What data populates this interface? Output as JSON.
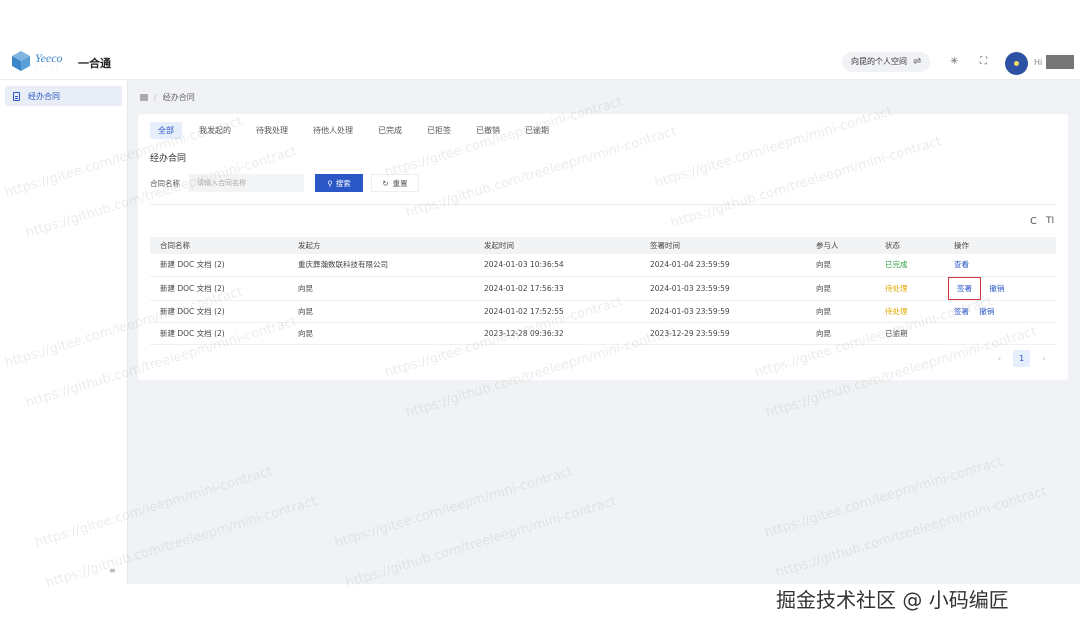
{
  "app": {
    "logo_brand": "Yeeco",
    "title": "一合通"
  },
  "topbar": {
    "space_label": "向昆的个人空间",
    "switch_symbol": "⇌",
    "theme_symbol": "✳",
    "fullscreen_symbol": "⛶",
    "greeting": "Hi"
  },
  "sidebar": {
    "items": [
      {
        "label": "经办合同",
        "icon": "document-icon",
        "active": true
      }
    ],
    "collapse_symbol": "≡"
  },
  "breadcrumb": {
    "current": "经办合同"
  },
  "tabs": [
    {
      "label": "全部",
      "active": true
    },
    {
      "label": "我发起的"
    },
    {
      "label": "待我处理"
    },
    {
      "label": "待他人处理"
    },
    {
      "label": "已完成"
    },
    {
      "label": "已拒签"
    },
    {
      "label": "已撤销"
    },
    {
      "label": "已逾期"
    }
  ],
  "section_title": "经办合同",
  "search": {
    "label": "合同名称",
    "placeholder": "请输入合同名称",
    "search_button": "搜索",
    "reset_button": "重置"
  },
  "toolbar": {
    "refresh_symbol": "C",
    "density_symbol": "TI"
  },
  "table": {
    "columns": [
      "合同名称",
      "发起方",
      "发起时间",
      "签署时间",
      "参与人",
      "状态",
      "操作"
    ],
    "rows": [
      {
        "name": "新建 DOC 文档 (2)",
        "initiator": "重庆葬瀚数联科技有限公司",
        "start": "2024-01-03 10:36:54",
        "sign": "2024-01-04 23:59:59",
        "participant": "向昆",
        "status": "已完成",
        "status_type": "done",
        "actions": [
          "查看"
        ]
      },
      {
        "name": "新建 DOC 文档 (2)",
        "initiator": "向昆",
        "start": "2024-01-02 17:56:33",
        "sign": "2024-01-03 23:59:59",
        "participant": "向昆",
        "status": "待处理",
        "status_type": "pending",
        "actions": [
          "签署",
          "撤销"
        ]
      },
      {
        "name": "新建 DOC 文档 (2)",
        "initiator": "向昆",
        "start": "2024-01-02 17:52:55",
        "sign": "2024-01-03 23:59:59",
        "participant": "向昆",
        "status": "待处理",
        "status_type": "pending",
        "actions": [
          "签署",
          "撤销"
        ]
      },
      {
        "name": "新建 DOC 文档 (2)",
        "initiator": "向昆",
        "start": "2023-12-28 09:36:32",
        "sign": "2023-12-29 23:59:59",
        "participant": "向昆",
        "status": "已逾期",
        "status_type": "expired",
        "actions": []
      }
    ]
  },
  "pagination": {
    "prev": "‹",
    "current": "1",
    "next": "›"
  },
  "footer_mark": "掘金技术社区 @ 小码编匠",
  "watermarks": [
    "https://gitee.com/leepm/mini-contract",
    "https://github.com/treeleepm/mini-contract"
  ]
}
